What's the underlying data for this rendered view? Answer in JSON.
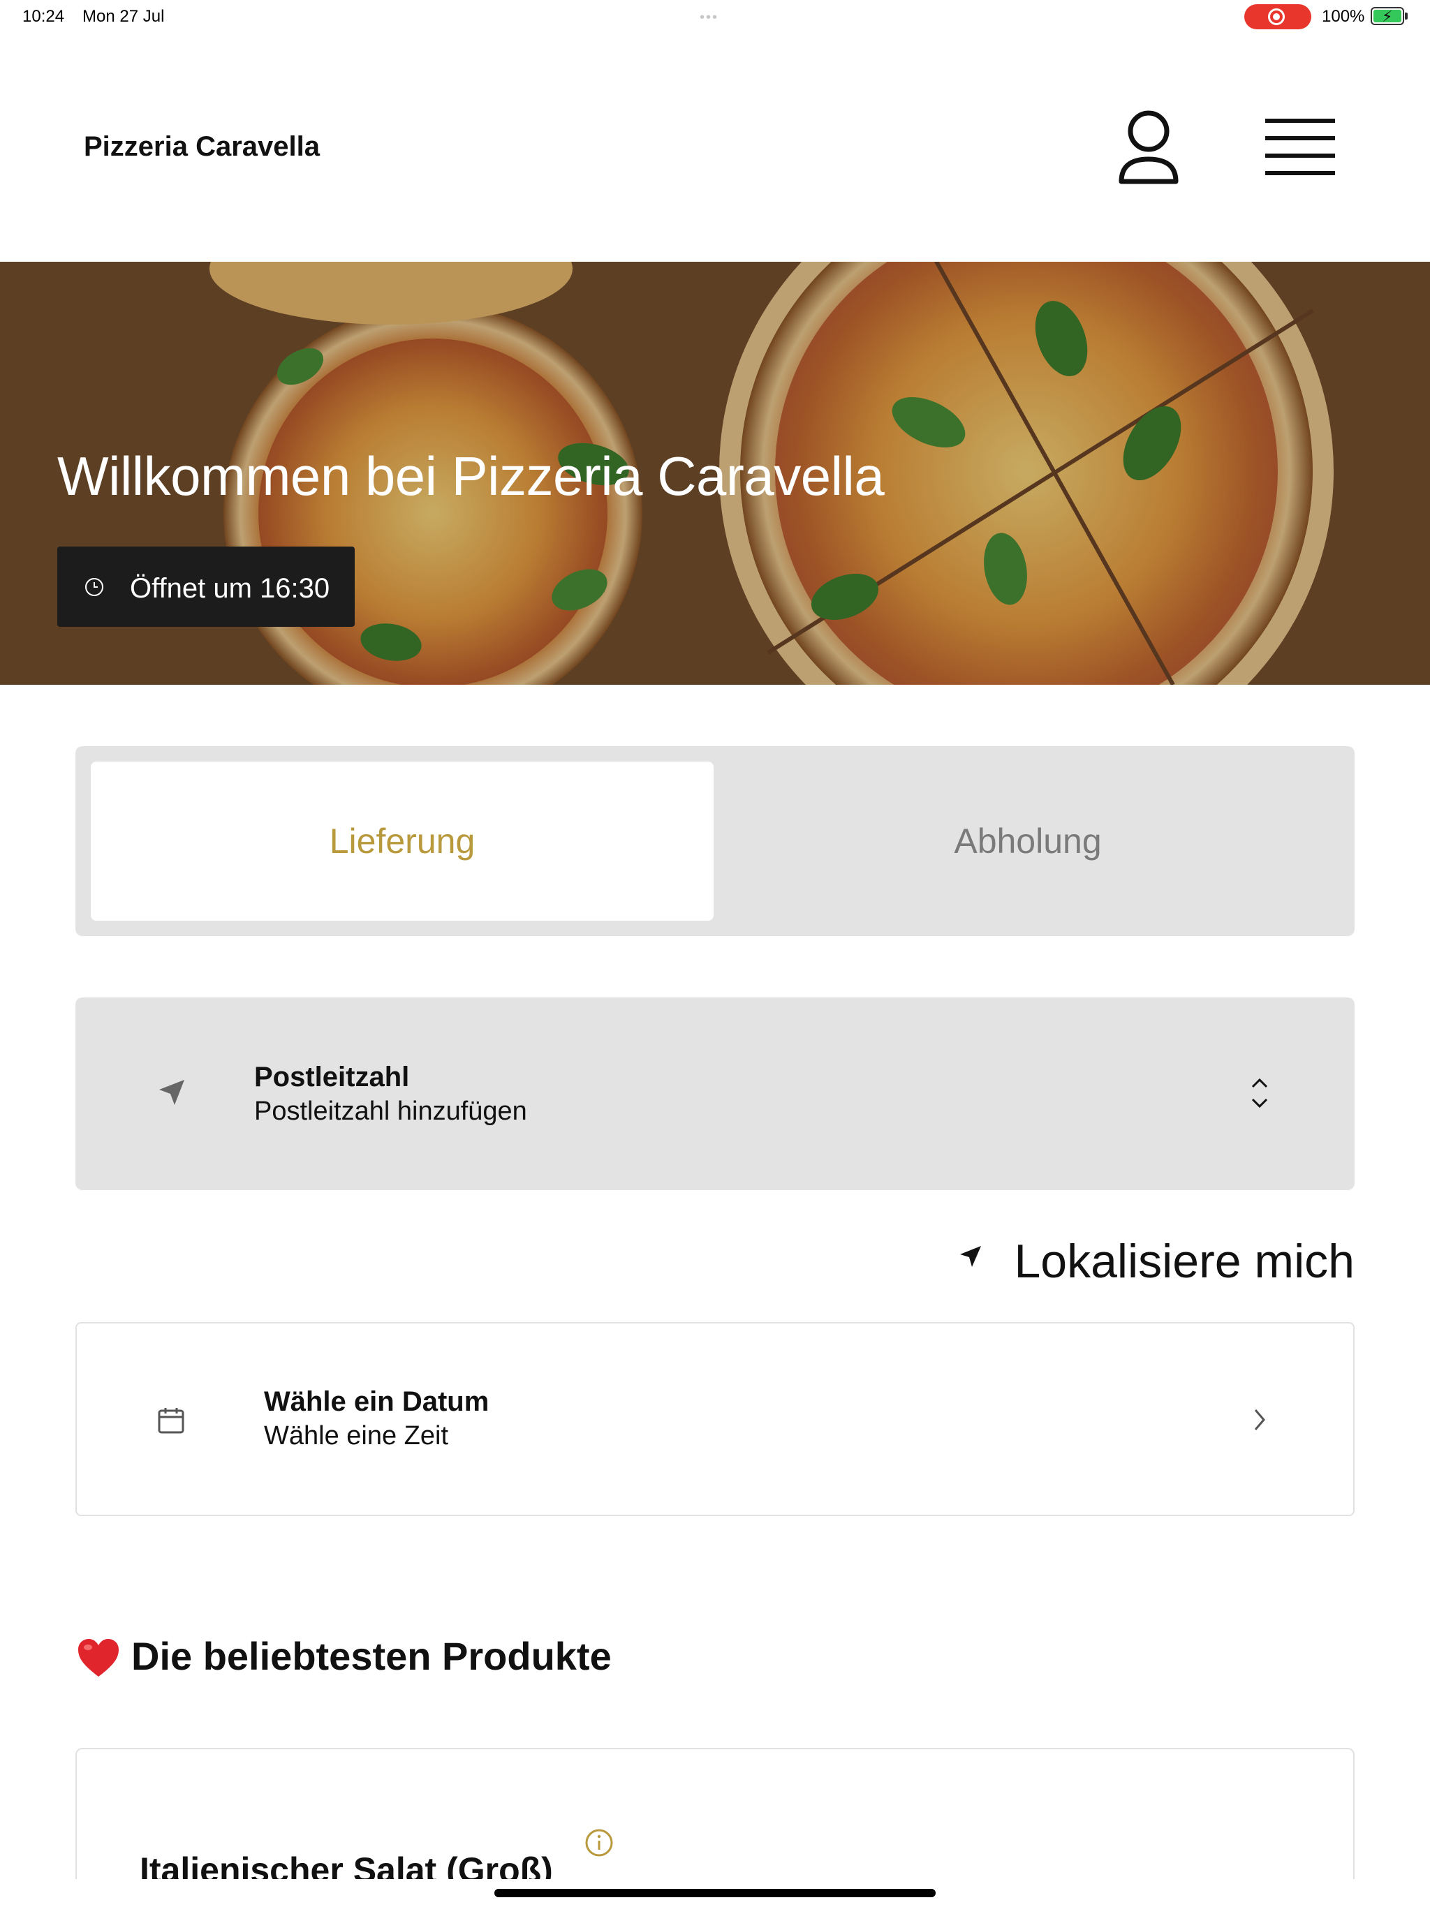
{
  "status_bar": {
    "time": "10:24",
    "date": "Mon 27 Jul",
    "battery_percent": "100%",
    "battery_level": 1.0,
    "recording": true
  },
  "header": {
    "brand": "Pizzeria Caravella",
    "account_icon": "user-icon",
    "menu_icon": "hamburger-menu-icon"
  },
  "hero": {
    "title": "Willkommen bei Pizzeria Caravella",
    "opening_label": "Öffnet um 16:30",
    "opening_icon": "clock-icon"
  },
  "order_mode": {
    "tabs": [
      {
        "label": "Lieferung",
        "active": true
      },
      {
        "label": "Abholung",
        "active": false
      }
    ],
    "active_color": "#b8993c"
  },
  "postcode": {
    "label": "Postleitzahl",
    "value": "Postleitzahl hinzufügen",
    "icon": "location-arrow-icon"
  },
  "locate": {
    "label": "Lokalisiere mich",
    "icon": "location-arrow-icon"
  },
  "schedule": {
    "date_label": "Wähle ein Datum",
    "time_label": "Wähle eine Zeit",
    "icon": "calendar-icon"
  },
  "popular": {
    "title": "Die beliebtesten Produkte",
    "emoji": "❤️",
    "products": [
      {
        "name": "Italienischer Salat (Groß)"
      }
    ]
  }
}
